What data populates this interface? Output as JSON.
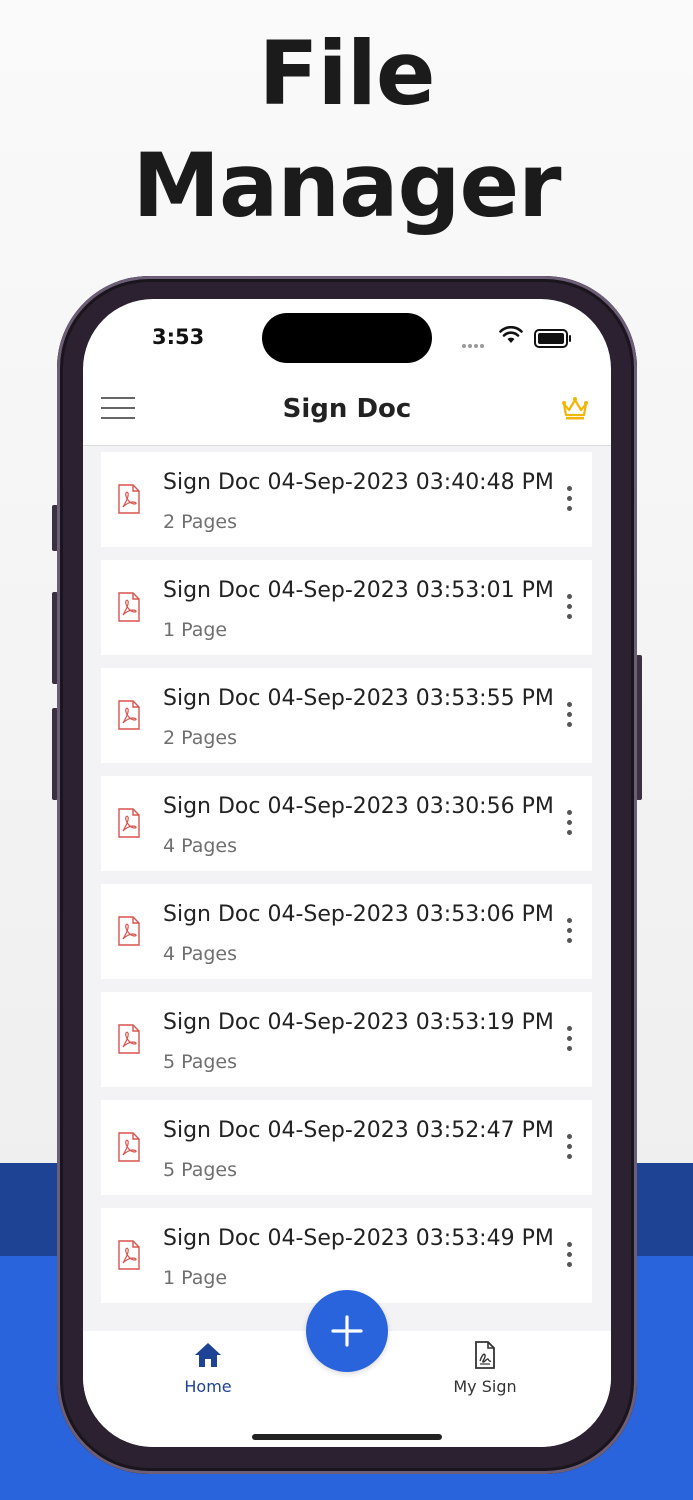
{
  "headline": {
    "line1": "File",
    "line2": "Manager"
  },
  "status_bar": {
    "time": "3:53"
  },
  "app_bar": {
    "title": "Sign Doc",
    "menu_icon": "hamburger-menu-icon",
    "premium_icon": "crown-icon",
    "accent": "#f2b705"
  },
  "documents": [
    {
      "title": "Sign Doc 04-Sep-2023 03:40:48 PM",
      "pages": "2 Pages"
    },
    {
      "title": "Sign Doc 04-Sep-2023 03:53:01 PM",
      "pages": "1 Page"
    },
    {
      "title": "Sign Doc 04-Sep-2023 03:53:55 PM",
      "pages": "2 Pages"
    },
    {
      "title": "Sign Doc 04-Sep-2023 03:30:56 PM",
      "pages": "4 Pages"
    },
    {
      "title": "Sign Doc 04-Sep-2023 03:53:06 PM",
      "pages": "4 Pages"
    },
    {
      "title": "Sign Doc 04-Sep-2023 03:53:19 PM",
      "pages": "5 Pages"
    },
    {
      "title": "Sign Doc 04-Sep-2023 03:52:47 PM",
      "pages": "5 Pages"
    },
    {
      "title": "Sign Doc 04-Sep-2023 03:53:49 PM",
      "pages": "1 Page"
    }
  ],
  "tab_bar": {
    "home_label": "Home",
    "sign_label": "My Sign",
    "active_color": "#1e4294",
    "inactive_color": "#333333",
    "fab_icon": "plus-icon"
  },
  "colors": {
    "brand_blue": "#2a64dd",
    "dark_blue": "#1e4294",
    "pdf_red": "#d9534f"
  }
}
